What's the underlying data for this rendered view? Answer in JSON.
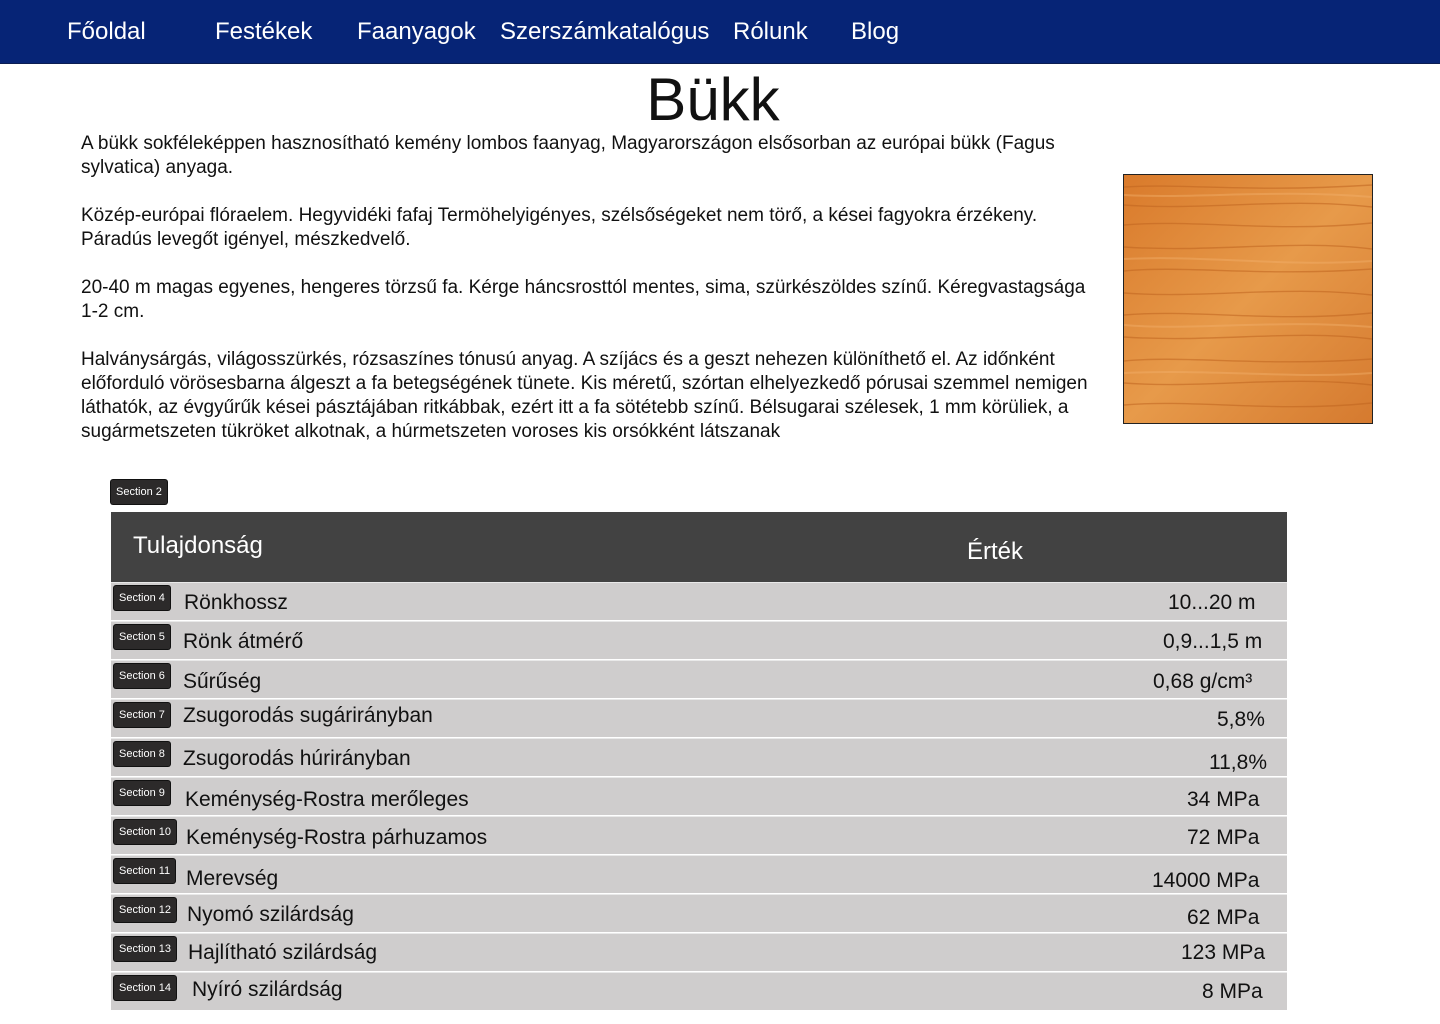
{
  "nav": {
    "items": [
      {
        "label": "Főoldal"
      },
      {
        "label": "Festékek"
      },
      {
        "label": "Faanyagok"
      },
      {
        "label": "Szerszámkatalógus"
      },
      {
        "label": "Rólunk"
      },
      {
        "label": "Blog"
      }
    ]
  },
  "page": {
    "title": "Bükk",
    "paragraphs": [
      "A bükk sokféleképpen hasznosítható kemény lombos faanyag, Magyarországon elsősorban az európai bükk (Fagus sylvatica) anyaga.",
      "Közép-európai flóraelem. Hegyvidéki fafaj Termöhelyigényes, szélsőségeket nem törő, a kései fagyokra érzékeny. Páradús levegőt igényel, mészkedvelő.",
      "20-40 m magas egyenes, hengeres törzsű fa. Kérge háncsrosttól mentes, sima, szürkészöldes színű. Kéregvastagsága 1-2 cm.",
      "Halványsárgás, világosszürkés, rózsaszínes tónusú anyag. A szíjács és a geszt nehezen különíthető el. Az időnként előforduló vörösesbarna álgeszt a fa betegségének tünete. Kis méretű, szórtan elhelyezkedő pórusai szemmel nemigen láthatók, az évgyűrűk kései pásztájában ritkábbak, ezért itt a fa sötétebb színű. Bélsugarai szélesek, 1 mm körüliek, a sugármetszeten tükröket alkotnak, a húrmetszeten voroses kis orsókként látszanak"
    ]
  },
  "section_badge": "Section 2",
  "table": {
    "header": {
      "property": "Tulajdonság",
      "value": "Érték"
    },
    "rows": [
      {
        "badge": "Section 4",
        "name": "Rönkhossz",
        "value": "10...20 m"
      },
      {
        "badge": "Section 5",
        "name": "Rönk átmérő",
        "value": "0,9...1,5 m"
      },
      {
        "badge": "Section 6",
        "name": "Sűrűség",
        "value": "0,68 g/cm³"
      },
      {
        "badge": "Section 7",
        "name": "Zsugorodás sugárirányban",
        "value": "5,8%"
      },
      {
        "badge": "Section 8",
        "name": "Zsugorodás húrirányban",
        "value": "11,8%"
      },
      {
        "badge": "Section 9",
        "name": "Keménység-Rostra merőleges",
        "value": "34 MPa"
      },
      {
        "badge": "Section 10",
        "name": "Keménység-Rostra párhuzamos",
        "value": "72 MPa"
      },
      {
        "badge": "Section 11",
        "name": "Merevség",
        "value": "14000 MPa"
      },
      {
        "badge": "Section 12",
        "name": "Nyomó szilárdság",
        "value": "62 MPa"
      },
      {
        "badge": "Section 13",
        "name": "Hajlítható szilárdság",
        "value": "123 MPa"
      },
      {
        "badge": "Section 14",
        "name": "Nyíró szilárdság",
        "value": "8 MPa"
      }
    ]
  },
  "colors": {
    "nav_background": "#062476",
    "table_header": "#424242",
    "table_row": "#cfcdcd",
    "badge": "#2c2a2a"
  }
}
